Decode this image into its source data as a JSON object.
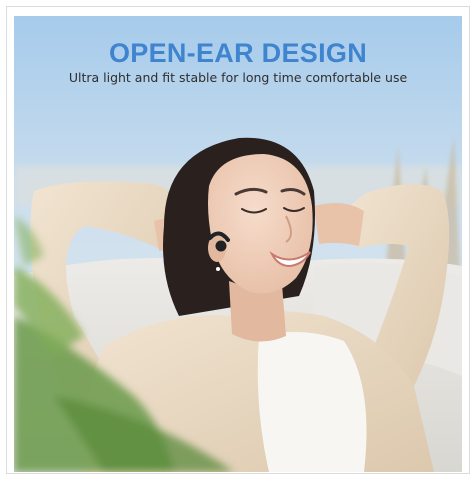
{
  "banner": {
    "headline": "OPEN-EAR DESIGN",
    "subline": "Ultra light and fit stable for long time comfortable use"
  },
  "colors": {
    "headline": "#3f84cf",
    "sky": "#a9cdec",
    "sofa": "#e4e3df",
    "shirt": "#ead9c3",
    "plant": "#6a9a4a"
  },
  "icons": {
    "earbud": "bone-conduction-earphone-icon"
  }
}
